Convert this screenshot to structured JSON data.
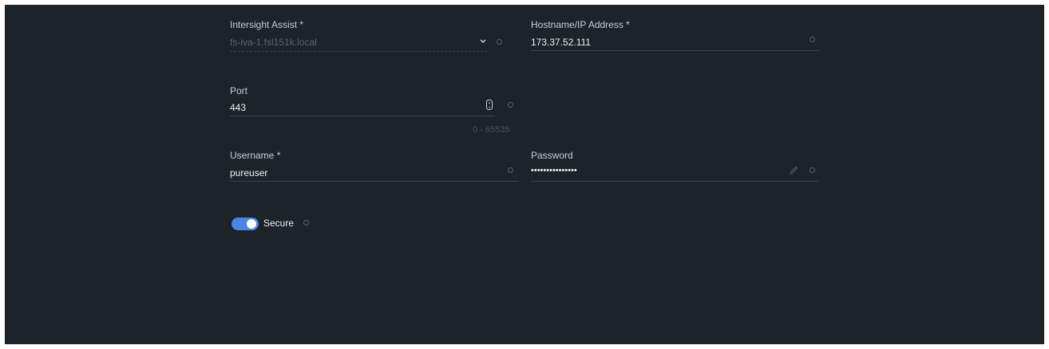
{
  "form": {
    "intersight_assist": {
      "label": "Intersight Assist *",
      "value": "fs-iva-1.fsl151k.local",
      "icons": [
        "chevron-down-icon",
        "info-icon"
      ]
    },
    "hostname": {
      "label": "Hostname/IP Address *",
      "value": "173.37.52.111",
      "icons": [
        "info-icon"
      ]
    },
    "port": {
      "label": "Port",
      "value": "443",
      "range_hint": "0 - 65535",
      "icons": [
        "stepper-icon",
        "info-icon"
      ]
    },
    "username": {
      "label": "Username *",
      "value": "pureuser",
      "icons": [
        "info-icon"
      ]
    },
    "password": {
      "label": "Password",
      "value": "•••••••••••••••",
      "icons": [
        "pencil-icon",
        "info-icon"
      ]
    },
    "secure": {
      "label": "Secure",
      "enabled": true,
      "icons": [
        "info-icon"
      ]
    }
  },
  "colors": {
    "background": "#1c2329",
    "accent": "#4d83e3",
    "text": "#eef1f3",
    "muted": "#5d666e"
  }
}
